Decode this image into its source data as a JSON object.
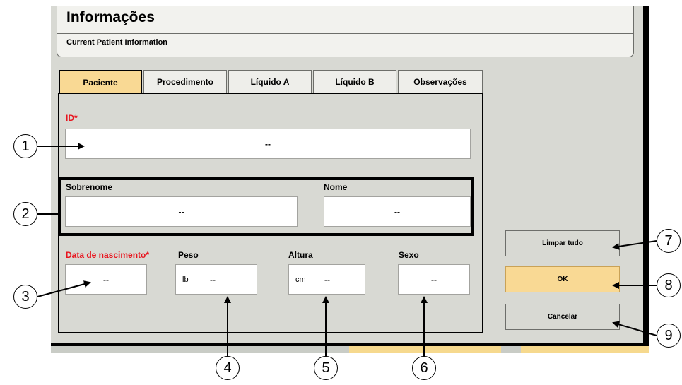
{
  "window": {
    "title": "Informações",
    "subtitle": "Current Patient Information"
  },
  "tabs": [
    {
      "label": "Paciente",
      "active": true
    },
    {
      "label": "Procedimento",
      "active": false
    },
    {
      "label": "Líquido A",
      "active": false
    },
    {
      "label": "Líquido B",
      "active": false
    },
    {
      "label": "Observações",
      "active": false
    }
  ],
  "form": {
    "id_label": "ID*",
    "id_value": "--",
    "surname_label": "Sobrenome",
    "surname_value": "--",
    "name_label": "Nome",
    "name_value": "--",
    "birthdate_label": "Data de nascimento*",
    "birthdate_value": "--",
    "weight_label": "Peso",
    "weight_unit": "lb",
    "weight_value": "--",
    "height_label": "Altura",
    "height_unit": "cm",
    "height_value": "--",
    "sex_label": "Sexo",
    "sex_value": "--"
  },
  "buttons": {
    "clear_all": "Limpar tudo",
    "ok": "OK",
    "cancel": "Cancelar"
  },
  "callouts": [
    "1",
    "2",
    "3",
    "4",
    "5",
    "6",
    "7",
    "8",
    "9"
  ],
  "colors": {
    "window_bg": "#d8d9d3",
    "active_tab": "#f9d994",
    "required_label": "#e8141e",
    "ok_button": "#f9d994"
  }
}
